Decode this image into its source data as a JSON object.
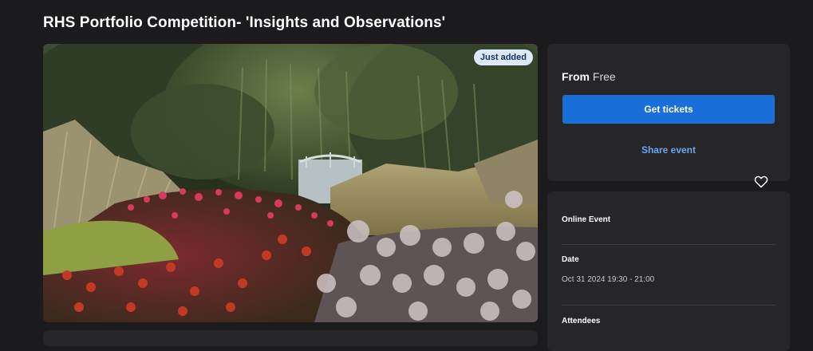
{
  "event": {
    "title": "RHS Portfolio Competition- 'Insights and Observations'",
    "badge": "Just added"
  },
  "tickets": {
    "from_label": "From",
    "price": "Free",
    "get_tickets_label": "Get tickets",
    "share_label": "Share event"
  },
  "info": {
    "location_label": "Online Event",
    "date_label": "Date",
    "date_value": "Oct 31 2024 19:30 - 21:00",
    "attendees_label": "Attendees"
  },
  "colors": {
    "background": "#1b1b1d",
    "card": "#262628",
    "primary_button": "#1a6ed8",
    "link": "#6aa7ef",
    "badge_bg": "#dde9f7"
  },
  "icons": {
    "favorite": "heart-outline-icon"
  }
}
